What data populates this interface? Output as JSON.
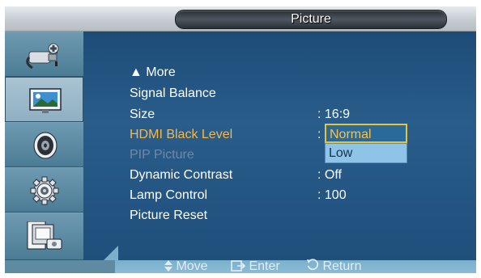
{
  "title": "Picture",
  "sidebar": {
    "items": [
      {
        "icon": "input-plug-icon",
        "active": false
      },
      {
        "icon": "picture-monitor-icon",
        "active": true
      },
      {
        "icon": "speaker-icon",
        "active": false
      },
      {
        "icon": "setup-gear-icon",
        "active": false
      },
      {
        "icon": "multi-control-icon",
        "active": false
      }
    ]
  },
  "menu": {
    "more_label": "▲ More",
    "items": [
      {
        "label": "Signal Balance",
        "value": ""
      },
      {
        "label": "Size",
        "value": ": 16:9"
      },
      {
        "label": "HDMI Black Level",
        "value": ":"
      },
      {
        "label": "PIP Picture",
        "value": ""
      },
      {
        "label": "Dynamic Contrast",
        "value": ": Off"
      },
      {
        "label": "Lamp Control",
        "value": ": 100"
      },
      {
        "label": "Picture Reset",
        "value": ""
      }
    ],
    "selected_index": 2,
    "disabled_index": 3
  },
  "dropdown": {
    "options": [
      "Normal",
      "Low"
    ],
    "highlighted": "Normal"
  },
  "hints": {
    "move": "Move",
    "enter": "Enter",
    "return": "Return"
  },
  "colors": {
    "selected_text": "#f6b84a",
    "disabled_text": "#6f8aa6",
    "main_bg": "#2a5d8b"
  }
}
